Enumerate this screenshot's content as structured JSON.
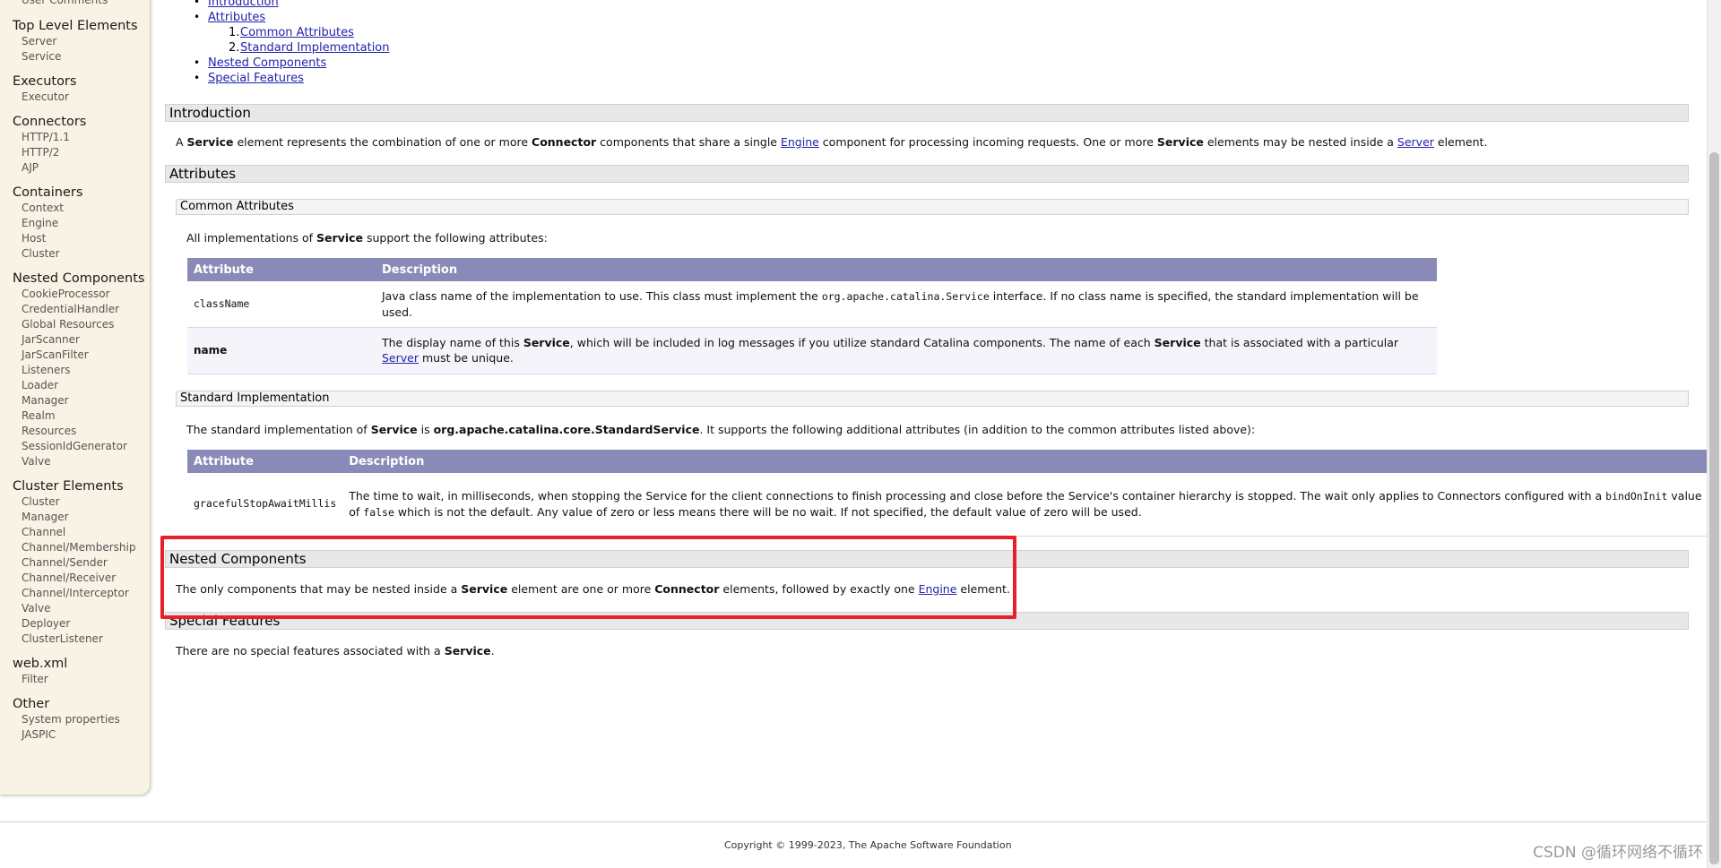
{
  "sidebar": {
    "cut_item": "User Comments",
    "groups": [
      {
        "title": "Top Level Elements",
        "items": [
          "Server",
          "Service"
        ]
      },
      {
        "title": "Executors",
        "items": [
          "Executor"
        ]
      },
      {
        "title": "Connectors",
        "items": [
          "HTTP/1.1",
          "HTTP/2",
          "AJP"
        ]
      },
      {
        "title": "Containers",
        "items": [
          "Context",
          "Engine",
          "Host",
          "Cluster"
        ]
      },
      {
        "title": "Nested Components",
        "items": [
          "CookieProcessor",
          "CredentialHandler",
          "Global Resources",
          "JarScanner",
          "JarScanFilter",
          "Listeners",
          "Loader",
          "Manager",
          "Realm",
          "Resources",
          "SessionIdGenerator",
          "Valve"
        ]
      },
      {
        "title": "Cluster Elements",
        "items": [
          "Cluster",
          "Manager",
          "Channel",
          "Channel/Membership",
          "Channel/Sender",
          "Channel/Receiver",
          "Channel/Interceptor",
          "Valve",
          "Deployer",
          "ClusterListener"
        ]
      },
      {
        "title": "web.xml",
        "items": [
          "Filter"
        ]
      },
      {
        "title": "Other",
        "items": [
          "System properties",
          "JASPIC"
        ]
      }
    ]
  },
  "toc": {
    "introduction": "Introduction",
    "attributes": "Attributes",
    "common_attributes": "Common Attributes",
    "standard_implementation": "Standard Implementation",
    "nested_components": "Nested Components",
    "special_features": "Special Features",
    "num1": "1.",
    "num2": "2."
  },
  "introduction": {
    "title": "Introduction",
    "t1": "A ",
    "b1": "Service",
    "t2": " element represents the combination of one or more ",
    "b2": "Connector",
    "t3": " components that share a single ",
    "l1": "Engine",
    "t4": " component for processing incoming requests. One or more ",
    "b3": "Service",
    "t5": " elements may be nested inside a ",
    "l2": "Server",
    "t6": " element."
  },
  "attributes": {
    "title": "Attributes",
    "common": {
      "title": "Common Attributes",
      "intro_t1": "All implementations of ",
      "intro_b1": "Service",
      "intro_t2": " support the following attributes:",
      "col_attribute": "Attribute",
      "col_description": "Description",
      "row1_name": "className",
      "row1_t1": "Java class name of the implementation to use. This class must implement the ",
      "row1_code": "org.apache.catalina.Service",
      "row1_t2": " interface. If no class name is specified, the standard implementation will be used.",
      "row2_name": "name",
      "row2_t1": "The display name of this ",
      "row2_b1": "Service",
      "row2_t2": ", which will be included in log messages if you utilize standard Catalina components. The name of each ",
      "row2_b2": "Service",
      "row2_t3": " that is associated with a particular ",
      "row2_link": "Server",
      "row2_t4": " must be unique."
    },
    "standard": {
      "title": "Standard Implementation",
      "intro_t1": "The standard implementation of ",
      "intro_b1": "Service",
      "intro_t2": " is ",
      "intro_b2": "org.apache.catalina.core.StandardService",
      "intro_t3": ". It supports the following additional attributes (in addition to the common attributes listed above):",
      "col_attribute": "Attribute",
      "col_description": "Description",
      "row1_name": "gracefulStopAwaitMillis",
      "row1_t1": "The time to wait, in milliseconds, when stopping the Service for the client connections to finish processing and close before the Service's container hierarchy is stopped. The wait only applies to Connectors configured with a ",
      "row1_code1": "bindOnInit",
      "row1_t2": " value",
      "row1_t3": "of ",
      "row1_code2": "false",
      "row1_t4": " which is not the default. Any value of zero or less means there will be no wait. If not specified, the default value of zero will be used."
    }
  },
  "nested": {
    "title": "Nested Components",
    "t1": "The only components that may be nested inside a ",
    "b1": "Service",
    "t2": " element are one or more ",
    "b2": "Connector",
    "t3": " elements, followed by exactly one ",
    "l1": "Engine",
    "t4": " element."
  },
  "special": {
    "title": "Special Features",
    "t1": "There are no special features associated with a ",
    "b1": "Service",
    "t2": "."
  },
  "footer": {
    "copyright": "Copyright © 1999-2023, The Apache Software Foundation",
    "watermark": "CSDN @循环网络不循环"
  },
  "colors": {
    "sidebar_bg": "#f8f3e4",
    "table_header": "#8a8ab8",
    "link": "#2222aa",
    "highlight": "#e8202a"
  }
}
